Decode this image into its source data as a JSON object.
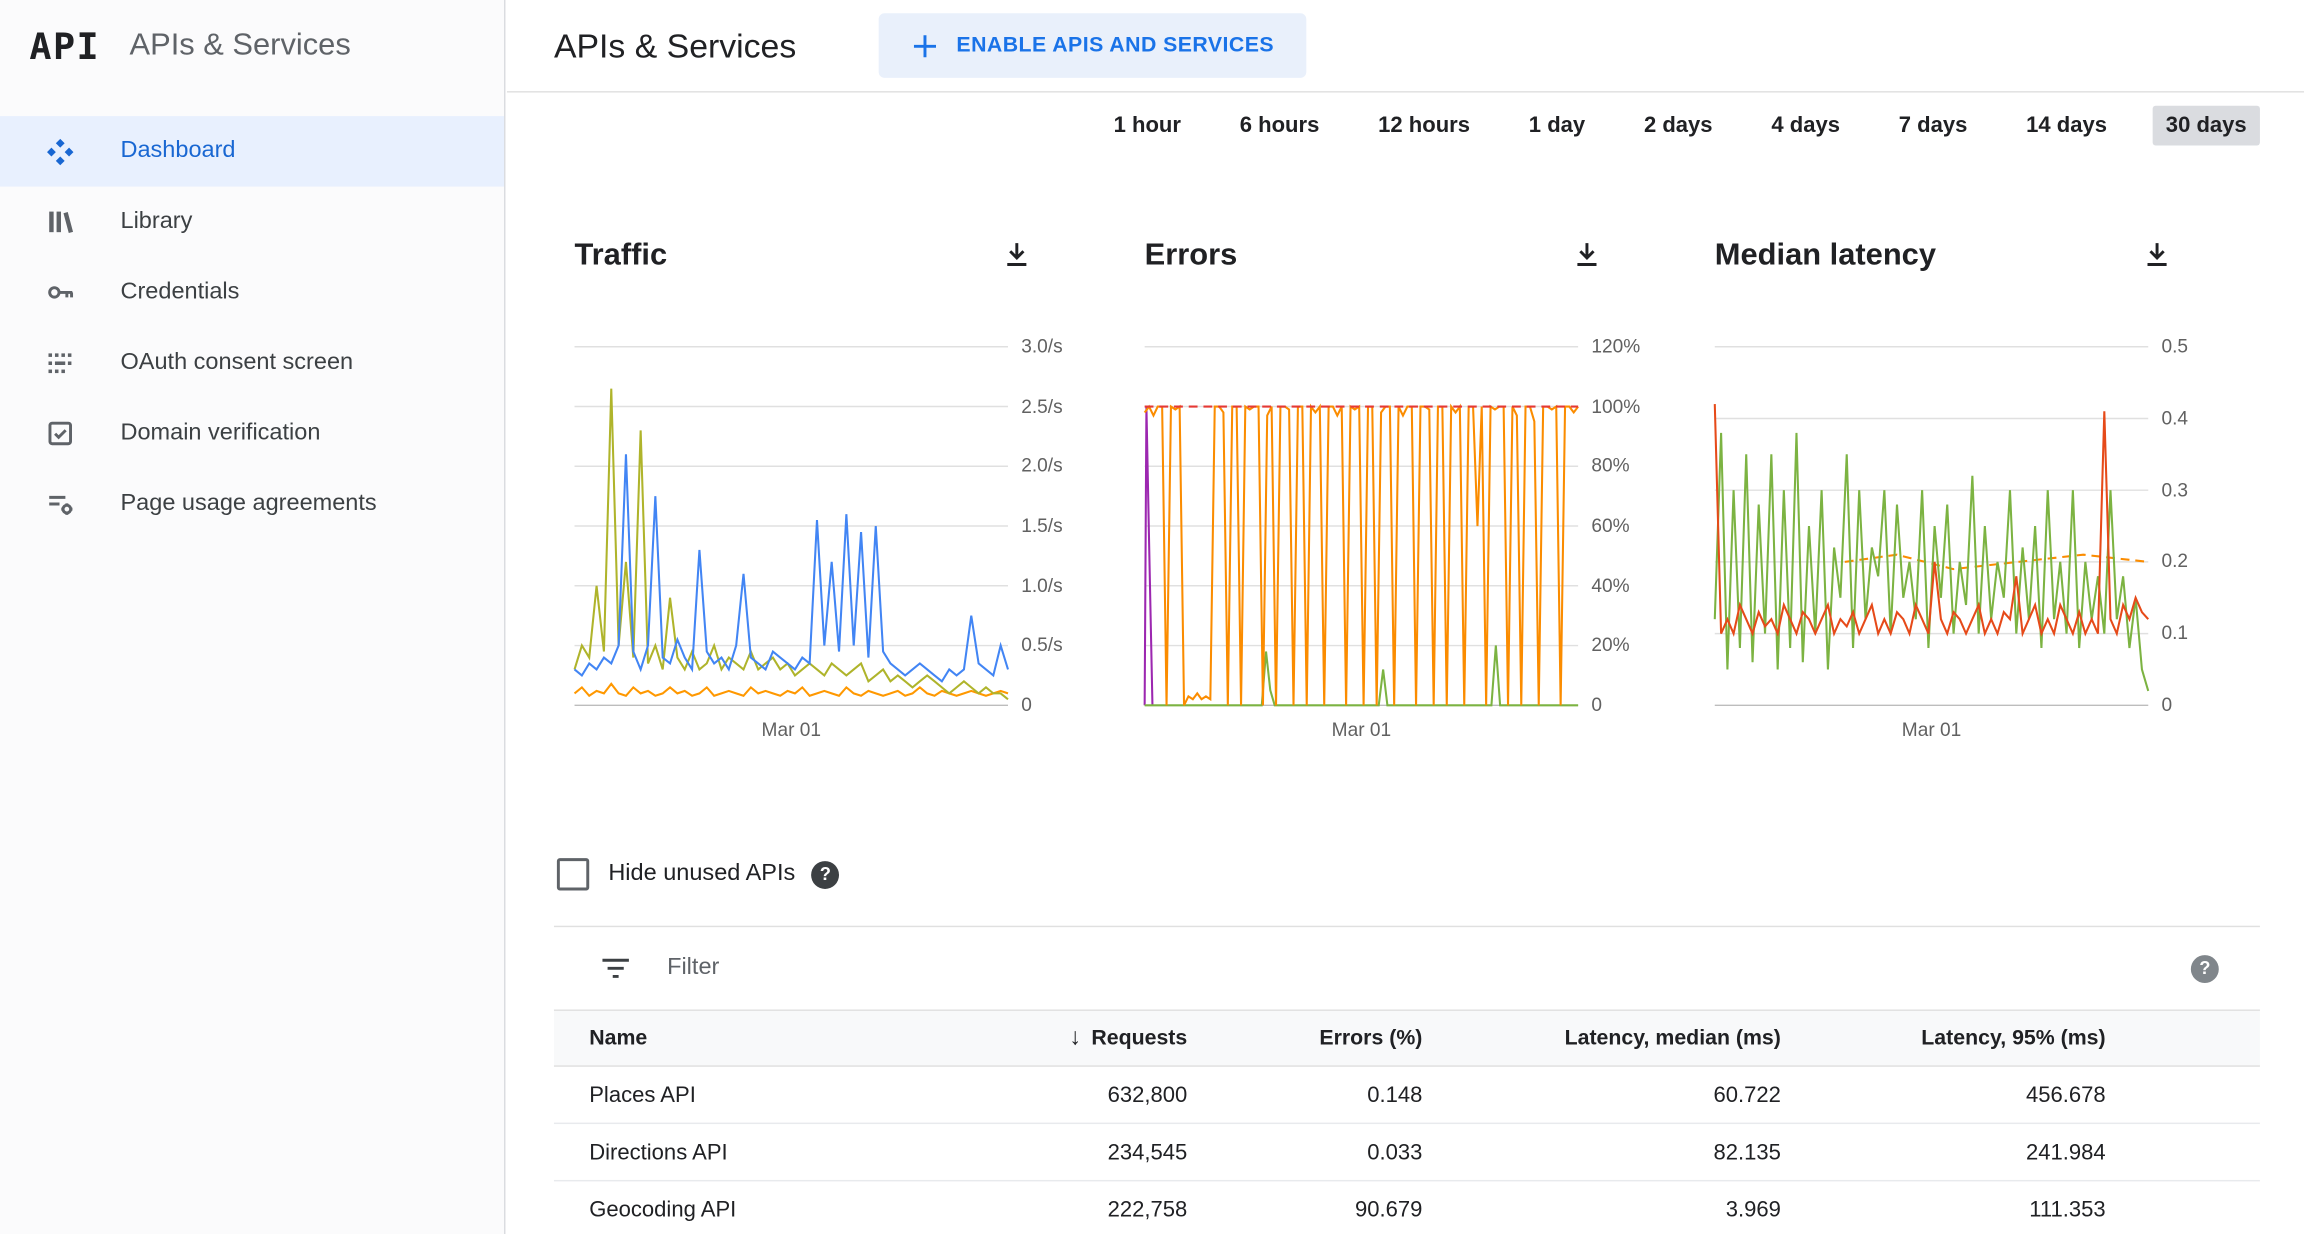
{
  "app": {
    "logo": "API",
    "product_name": "APIs & Services"
  },
  "sidebar": {
    "items": [
      {
        "label": "Dashboard",
        "icon": "dashboard-icon",
        "selected": true
      },
      {
        "label": "Library",
        "icon": "library-icon",
        "selected": false
      },
      {
        "label": "Credentials",
        "icon": "key-icon",
        "selected": false
      },
      {
        "label": "OAuth consent screen",
        "icon": "oauth-consent-icon",
        "selected": false
      },
      {
        "label": "Domain verification",
        "icon": "domain-verification-icon",
        "selected": false
      },
      {
        "label": "Page usage agreements",
        "icon": "page-usage-icon",
        "selected": false
      }
    ]
  },
  "header": {
    "title": "APIs & Services",
    "enable_button_label": "ENABLE APIS AND SERVICES"
  },
  "time_ranges": {
    "options": [
      "1 hour",
      "6 hours",
      "12 hours",
      "1 day",
      "2 days",
      "4 days",
      "7 days",
      "14 days",
      "30 days"
    ],
    "selected": "30 days"
  },
  "icons": {
    "help": "?",
    "sort_desc": "↓"
  },
  "hide_unused": {
    "label": "Hide unused APIs"
  },
  "filter": {
    "placeholder": "Filter"
  },
  "table": {
    "columns": {
      "name": "Name",
      "requests": "Requests",
      "errors": "Errors (%)",
      "latency_median": "Latency, median (ms)",
      "latency_95": "Latency, 95% (ms)"
    },
    "rows": [
      {
        "name": "Places API",
        "requests": "632,800",
        "errors": "0.148",
        "latency_median": "60.722",
        "latency_95": "456.678"
      },
      {
        "name": "Directions API",
        "requests": "234,545",
        "errors": "0.033",
        "latency_median": "82.135",
        "latency_95": "241.984"
      },
      {
        "name": "Geocoding API",
        "requests": "222,758",
        "errors": "90.679",
        "latency_median": "3.969",
        "latency_95": "111.353"
      }
    ]
  },
  "chart_data": [
    {
      "type": "line",
      "title": "Traffic",
      "ylim": [
        0,
        3
      ],
      "y_ticks": [
        "3.0/s",
        "2.5/s",
        "2.0/s",
        "1.5/s",
        "1.0/s",
        "0.5/s",
        "0"
      ],
      "x_tick": "Mar 01",
      "grid": true,
      "legend": "none",
      "series": [
        {
          "name": "orange",
          "color": "#FF9800",
          "values": [
            0.1,
            0.15,
            0.08,
            0.12,
            0.1,
            0.18,
            0.1,
            0.08,
            0.15,
            0.1,
            0.12,
            0.08,
            0.1,
            0.15,
            0.1,
            0.12,
            0.08,
            0.1,
            0.15,
            0.08,
            0.1,
            0.12,
            0.1,
            0.08,
            0.15,
            0.1,
            0.12,
            0.1,
            0.08,
            0.12,
            0.1,
            0.15,
            0.08,
            0.1,
            0.12,
            0.1,
            0.08,
            0.15,
            0.1,
            0.08,
            0.12,
            0.1,
            0.08,
            0.1,
            0.12,
            0.08,
            0.1,
            0.15,
            0.1,
            0.08,
            0.12,
            0.1,
            0.08,
            0.1,
            0.12,
            0.1,
            0.08,
            0.1,
            0.12,
            0.1
          ]
        },
        {
          "name": "olive",
          "color": "#AFB42B",
          "values": [
            0.3,
            0.5,
            0.4,
            1.0,
            0.45,
            2.65,
            0.5,
            1.2,
            0.4,
            2.3,
            0.35,
            0.5,
            0.3,
            0.9,
            0.4,
            0.3,
            0.45,
            0.3,
            0.35,
            0.5,
            0.3,
            0.4,
            0.35,
            0.3,
            0.45,
            0.3,
            0.35,
            0.4,
            0.3,
            0.35,
            0.25,
            0.3,
            0.35,
            0.3,
            0.25,
            0.35,
            0.3,
            0.25,
            0.3,
            0.35,
            0.2,
            0.25,
            0.3,
            0.2,
            0.25,
            0.2,
            0.15,
            0.2,
            0.25,
            0.2,
            0.15,
            0.1,
            0.15,
            0.2,
            0.15,
            0.1,
            0.15,
            0.1,
            0.1,
            0.05
          ]
        },
        {
          "name": "blue",
          "color": "#4285F4",
          "values": [
            0.3,
            0.25,
            0.35,
            0.3,
            0.4,
            0.35,
            0.5,
            2.1,
            0.45,
            0.3,
            0.5,
            1.75,
            0.4,
            0.35,
            0.55,
            0.4,
            0.3,
            1.3,
            0.45,
            0.35,
            0.4,
            0.3,
            0.5,
            1.1,
            0.4,
            0.35,
            0.3,
            0.45,
            0.4,
            0.35,
            0.3,
            0.4,
            0.35,
            1.55,
            0.5,
            1.2,
            0.45,
            1.6,
            0.5,
            1.45,
            0.4,
            1.5,
            0.45,
            0.35,
            0.3,
            0.25,
            0.3,
            0.35,
            0.3,
            0.25,
            0.2,
            0.3,
            0.25,
            0.3,
            0.75,
            0.35,
            0.3,
            0.25,
            0.5,
            0.3
          ]
        }
      ]
    },
    {
      "type": "line",
      "title": "Errors",
      "ylim": [
        0,
        120
      ],
      "y_ticks": [
        "120%",
        "100%",
        "80%",
        "60%",
        "40%",
        "20%",
        "0"
      ],
      "x_tick": "Mar 01",
      "grid": true,
      "legend": "none",
      "series": [
        {
          "name": "purple",
          "color": "#9C27B0",
          "x": [
            0,
            0.004,
            0.01,
            0.018
          ],
          "values": [
            0,
            100,
            55,
            0
          ]
        },
        {
          "name": "green",
          "color": "#7CB342",
          "x": [
            0,
            0.27,
            0.28,
            0.29,
            0.3,
            0.54,
            0.55,
            0.56,
            0.8,
            0.81,
            0.82,
            1
          ],
          "values": [
            0,
            0,
            18,
            5,
            0,
            0,
            12,
            0,
            0,
            20,
            0,
            0
          ]
        },
        {
          "name": "orange",
          "color": "#FB8C00",
          "values": [
            98,
            100,
            97,
            100,
            100,
            0,
            100,
            99,
            100,
            0,
            3,
            2,
            4,
            2,
            3,
            2,
            100,
            100,
            98,
            0,
            100,
            100,
            0,
            100,
            99,
            100,
            100,
            0,
            97,
            100,
            0,
            100,
            100,
            99,
            0,
            100,
            100,
            0,
            100,
            98,
            100,
            0,
            100,
            100,
            97,
            100,
            0,
            100,
            99,
            100,
            0,
            100,
            100,
            0,
            98,
            100,
            100,
            0,
            100,
            97,
            100,
            100,
            0,
            100,
            100,
            99,
            0,
            100,
            100,
            0,
            100,
            98,
            100,
            0,
            100,
            100,
            60,
            100,
            0,
            100,
            99,
            100,
            100,
            0,
            100,
            97,
            0,
            100,
            100,
            95,
            0,
            100,
            100,
            99,
            100,
            0,
            100,
            100,
            98,
            100
          ]
        },
        {
          "name": "limit",
          "color": "#E53935",
          "dash": true,
          "x": [
            0,
            1
          ],
          "values": [
            100,
            100
          ]
        }
      ]
    },
    {
      "type": "line",
      "title": "Median latency",
      "ylim": [
        0,
        0.5
      ],
      "y_ticks": [
        "0.5",
        "0.4",
        "0.3",
        "0.2",
        "0.1",
        "0"
      ],
      "x_tick": "Mar 01",
      "grid": true,
      "legend": "none",
      "series": [
        {
          "name": "orange-dashed",
          "color": "#FB8C00",
          "dash": true,
          "x": [
            0.3,
            0.42,
            0.55,
            0.7,
            0.85,
            1
          ],
          "values": [
            0.2,
            0.21,
            0.19,
            0.2,
            0.21,
            0.2
          ]
        },
        {
          "name": "green",
          "color": "#7CB342",
          "values": [
            0.12,
            0.38,
            0.05,
            0.3,
            0.08,
            0.35,
            0.06,
            0.28,
            0.1,
            0.35,
            0.05,
            0.3,
            0.08,
            0.38,
            0.06,
            0.25,
            0.1,
            0.3,
            0.05,
            0.22,
            0.15,
            0.35,
            0.08,
            0.3,
            0.12,
            0.22,
            0.18,
            0.3,
            0.1,
            0.28,
            0.15,
            0.2,
            0.12,
            0.3,
            0.08,
            0.25,
            0.15,
            0.28,
            0.1,
            0.2,
            0.14,
            0.32,
            0.1,
            0.25,
            0.12,
            0.2,
            0.15,
            0.3,
            0.1,
            0.22,
            0.12,
            0.25,
            0.08,
            0.3,
            0.12,
            0.2,
            0.1,
            0.3,
            0.08,
            0.2,
            0.12,
            0.18,
            0.1,
            0.3,
            0.12,
            0.18,
            0.08,
            0.15,
            0.05,
            0.02
          ]
        },
        {
          "name": "red",
          "color": "#E64A19",
          "values": [
            0.42,
            0.1,
            0.12,
            0.1,
            0.14,
            0.12,
            0.1,
            0.13,
            0.11,
            0.12,
            0.1,
            0.14,
            0.12,
            0.1,
            0.13,
            0.12,
            0.1,
            0.12,
            0.14,
            0.1,
            0.12,
            0.11,
            0.13,
            0.1,
            0.12,
            0.14,
            0.1,
            0.12,
            0.1,
            0.13,
            0.12,
            0.1,
            0.14,
            0.12,
            0.1,
            0.2,
            0.12,
            0.1,
            0.13,
            0.12,
            0.1,
            0.12,
            0.14,
            0.1,
            0.12,
            0.1,
            0.13,
            0.12,
            0.18,
            0.1,
            0.12,
            0.14,
            0.1,
            0.12,
            0.1,
            0.14,
            0.12,
            0.1,
            0.13,
            0.1,
            0.12,
            0.1,
            0.41,
            0.12,
            0.1,
            0.14,
            0.12,
            0.15,
            0.13,
            0.12
          ]
        }
      ]
    }
  ]
}
